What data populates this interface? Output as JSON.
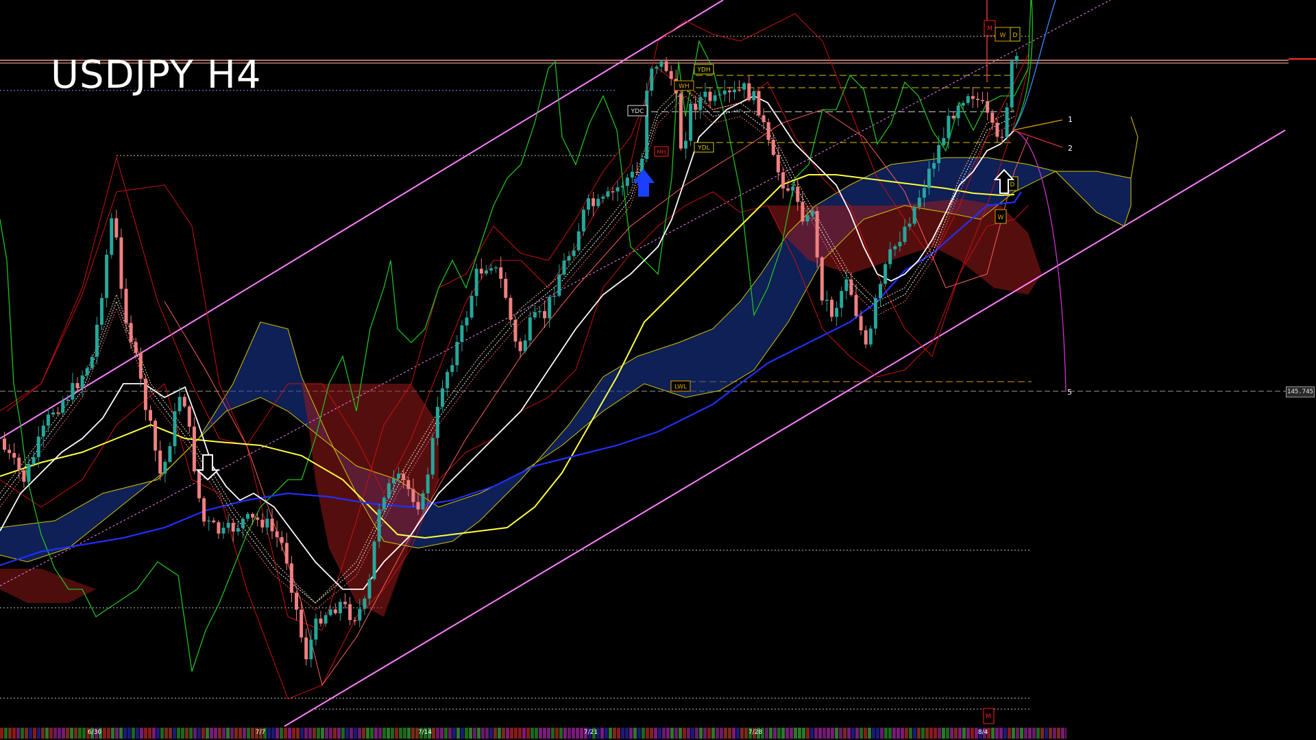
{
  "title": "USDJPY H4",
  "current_price_label": "145.745",
  "date_labels": [
    "6/30",
    "7/7",
    "7/14",
    "7/21",
    "7/28",
    "8/4"
  ],
  "level_labels": {
    "ydh": "YDH",
    "ydc": "YDC",
    "ydl": "YDL",
    "lwl": "LWL",
    "wh": "WH",
    "mh": "MH",
    "m_top": "M",
    "w_top": "W",
    "d_top": "D",
    "w_low": "W",
    "m_bottom": "M",
    "d_right": "D"
  },
  "fib_labels": [
    "1",
    "2",
    "5"
  ],
  "colors": {
    "background": "#000000",
    "bull_candle": "#26a69a",
    "bear_candle": "#f08080",
    "channel": "#ff80ff",
    "ema_white": "#ffffff",
    "sma_yellow": "#ffff40",
    "sma_blue": "#2030ff",
    "bollinger_red": "#cc1010",
    "rsi_green": "#20c020",
    "cloud_blue": "#1a3a9a",
    "cloud_red": "#9a1a1a"
  },
  "chart_data": {
    "type": "candlestick",
    "title": "USDJPY H4",
    "x_tick_labels": [
      "6/30",
      "7/7",
      "7/14",
      "7/21",
      "7/28",
      "8/4"
    ],
    "current_price": 145.745,
    "indicators": [
      "moving averages (white, yellow, blue)",
      "ichimoku cloud",
      "bollinger bands",
      "price channel"
    ],
    "arrows": [
      {
        "direction": "down",
        "near": "7/3"
      },
      {
        "direction": "up",
        "near": "7/20"
      },
      {
        "direction": "up",
        "near": "8/4"
      }
    ]
  }
}
